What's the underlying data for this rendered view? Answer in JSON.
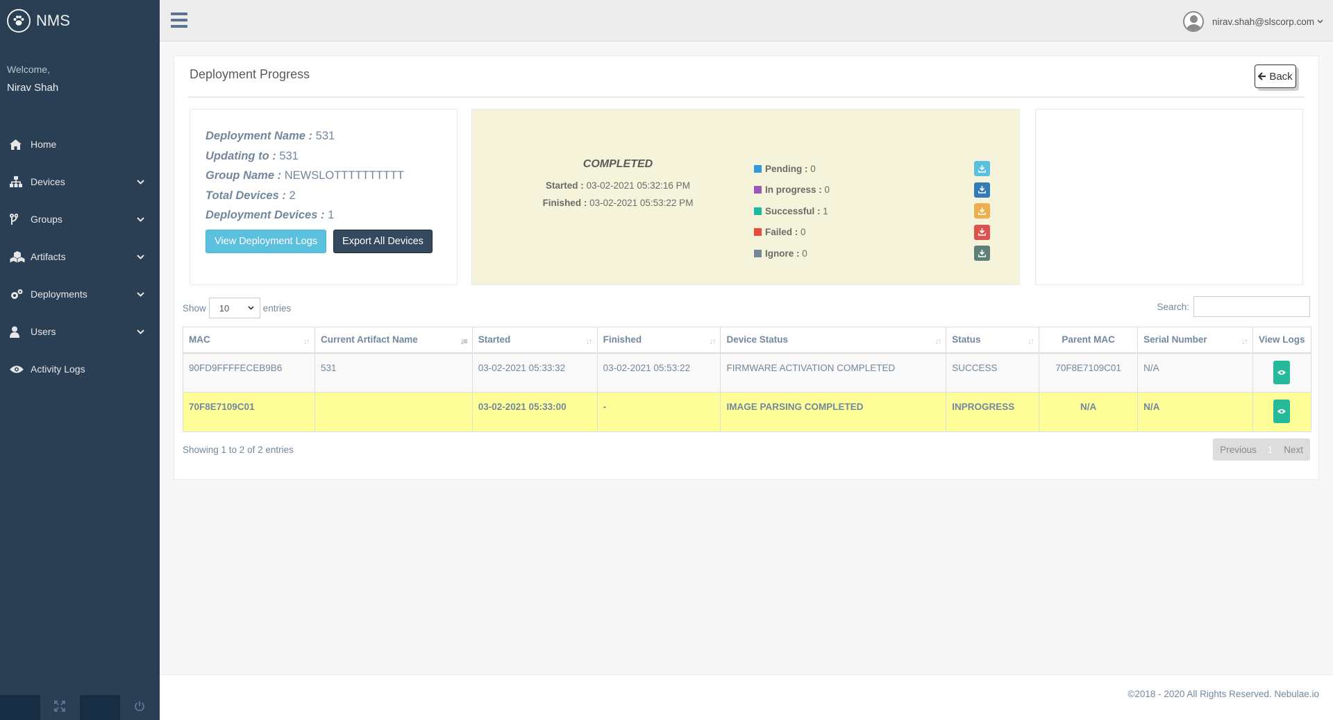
{
  "brand": {
    "title": "NMS",
    "logo_icon": "paw-icon"
  },
  "welcome": {
    "label": "Welcome,",
    "name": "Nirav Shah"
  },
  "sidebar": {
    "items": [
      {
        "label": "Home",
        "icon": "home-icon",
        "has_submenu": false
      },
      {
        "label": "Devices",
        "icon": "sitemap-icon",
        "has_submenu": true
      },
      {
        "label": "Groups",
        "icon": "code-fork-icon",
        "has_submenu": true
      },
      {
        "label": "Artifacts",
        "icon": "cubes-icon",
        "has_submenu": true
      },
      {
        "label": "Deployments",
        "icon": "cogs-icon",
        "has_submenu": true
      },
      {
        "label": "Users",
        "icon": "user-icon",
        "has_submenu": true
      },
      {
        "label": "Activity Logs",
        "icon": "eye-icon",
        "has_submenu": false
      }
    ]
  },
  "topnav": {
    "user_email": "nirav.shah@slscorp.com"
  },
  "page": {
    "title": "Deployment Progress",
    "back_label": "Back"
  },
  "deployment": {
    "name_key": "Deployment Name :",
    "name": "531",
    "updating_key": "Updating to :",
    "updating": "531",
    "group_key": "Group Name :",
    "group": "NEWSLOTTTTTTTTTT",
    "total_key": "Total Devices :",
    "total": "2",
    "dep_devices_key": "Deployment Devices :",
    "dep_devices": "1",
    "view_logs_label": "View Deployment Logs",
    "export_label": "Export All Devices"
  },
  "status": {
    "state": "COMPLETED",
    "started_key": "Started :",
    "started": "03-02-2021 05:32:16 PM",
    "finished_key": "Finished :",
    "finished": "03-02-2021 05:53:22 PM",
    "legend": [
      {
        "label": "Pending :",
        "value": "0",
        "color": "#3498db",
        "btn_color": "#5bc0de"
      },
      {
        "label": "In progress :",
        "value": "0",
        "color": "#9b59b6",
        "btn_color": "#337ab7"
      },
      {
        "label": "Successful :",
        "value": "1",
        "color": "#1abb9c",
        "btn_color": "#f0ad4e"
      },
      {
        "label": "Failed :",
        "value": "0",
        "color": "#e74c3c",
        "btn_color": "#d9534f"
      },
      {
        "label": "Ignore :",
        "value": "0",
        "color": "#73879c",
        "btn_color": "#5f7f7a"
      }
    ]
  },
  "table_controls": {
    "show": "Show",
    "entries": "entries",
    "length": "10",
    "search": "Search:"
  },
  "table": {
    "columns": [
      "MAC",
      "Current Artifact Name",
      "Started",
      "Finished",
      "Device Status",
      "Status",
      "Parent MAC",
      "Serial Number",
      "View Logs"
    ],
    "rows": [
      [
        "90FD9FFFFECEB9B6",
        "531",
        "03-02-2021 05:33:32",
        "03-02-2021 05:53:22",
        "FIRMWARE ACTIVATION COMPLETED",
        "SUCCESS",
        "70F8E7109C01",
        "N/A"
      ],
      [
        "70F8E7109C01",
        "",
        "03-02-2021 05:33:00",
        "-",
        "IMAGE PARSING COMPLETED",
        "INPROGRESS",
        "N/A",
        "N/A"
      ]
    ],
    "info": "Showing 1 to 2 of 2 entries",
    "prev": "Previous",
    "page": "1",
    "next": "Next"
  },
  "footer": {
    "copyright": "©2018 - 2020 All Rights Reserved. Nebulae.io"
  }
}
